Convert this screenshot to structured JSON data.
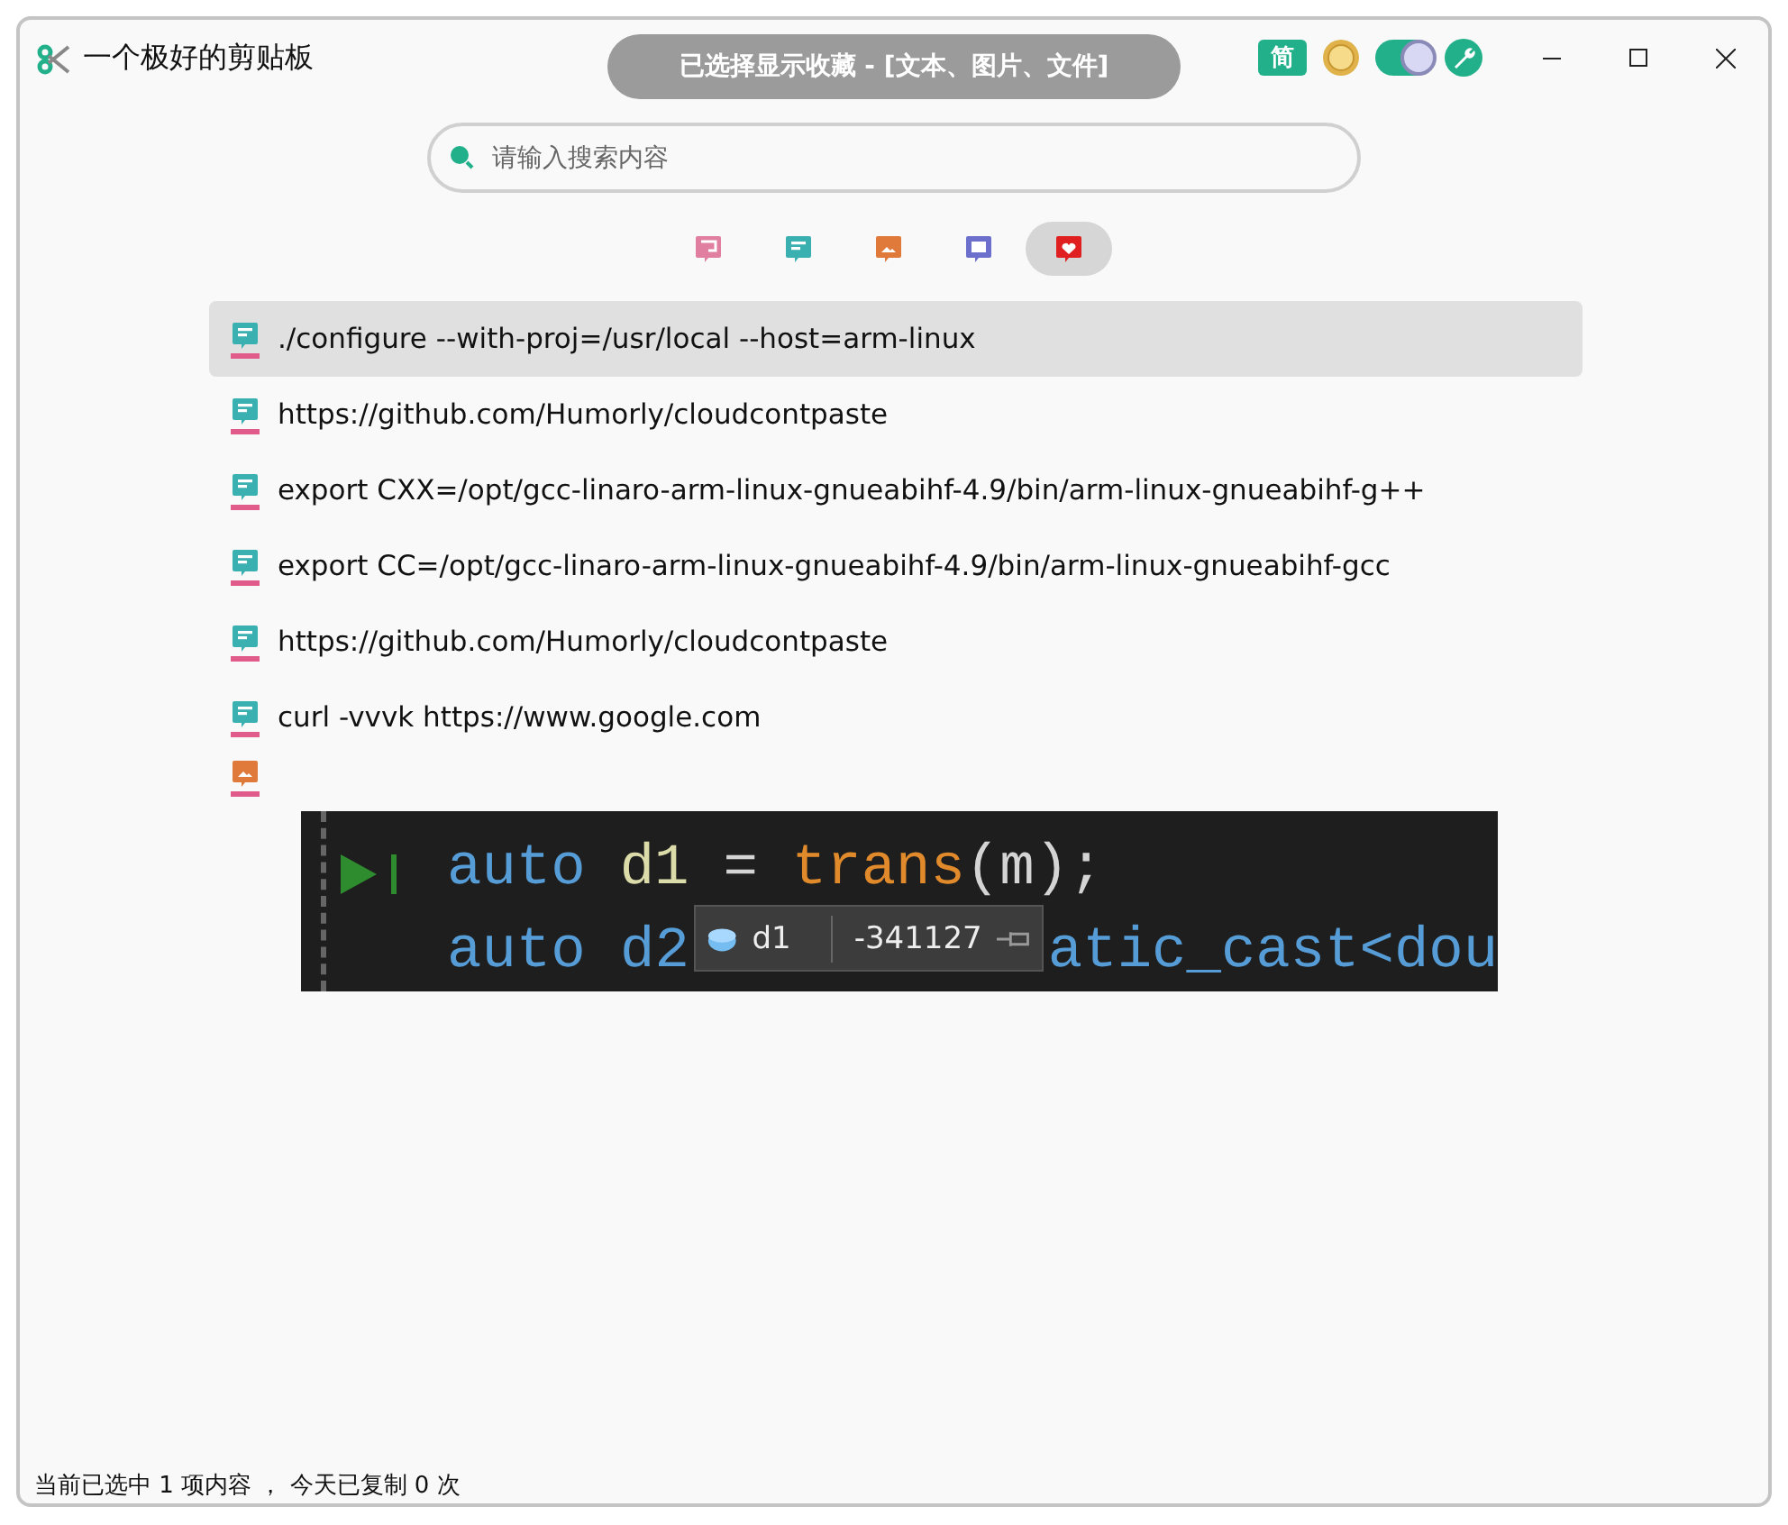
{
  "window": {
    "title": "一个极好的剪贴板"
  },
  "banner": "已选择显示收藏 - [文本、图片、文件]",
  "toolbar": {
    "language_badge": "简",
    "theme_toggle": {
      "on": true
    }
  },
  "search": {
    "placeholder": "请输入搜索内容"
  },
  "filters": [
    {
      "kind": "all",
      "selected": false
    },
    {
      "kind": "text",
      "selected": false
    },
    {
      "kind": "image",
      "selected": false
    },
    {
      "kind": "file",
      "selected": false
    },
    {
      "kind": "favorite",
      "selected": true
    }
  ],
  "items": [
    {
      "kind": "text",
      "text": "./configure --with-proj=/usr/local --host=arm-linux",
      "selected": true
    },
    {
      "kind": "text",
      "text": "https://github.com/Humorly/cloudcontpaste",
      "selected": false
    },
    {
      "kind": "text",
      "text": "export CXX=/opt/gcc-linaro-arm-linux-gnueabihf-4.9/bin/arm-linux-gnueabihf-g++",
      "selected": false
    },
    {
      "kind": "text",
      "text": "export CC=/opt/gcc-linaro-arm-linux-gnueabihf-4.9/bin/arm-linux-gnueabihf-gcc",
      "selected": false
    },
    {
      "kind": "text",
      "text": "https://github.com/Humorly/cloudcontpaste",
      "selected": false
    },
    {
      "kind": "text",
      "text": "curl -vvvk https://www.google.com",
      "selected": false
    },
    {
      "kind": "image",
      "selected": false,
      "code": {
        "lines": [
          [
            {
              "kind": "keyword",
              "text": "auto"
            },
            {
              "kind": "var",
              "text": "d1"
            },
            {
              "kind": "op",
              "text": "="
            },
            {
              "kind": "func",
              "text": "trans"
            },
            {
              "kind": "plain",
              "text": "(m);"
            }
          ],
          [
            {
              "kind": "keyword",
              "text": "auto d2"
            },
            {
              "kind": "keyword",
              "text": "atic_cast<dou"
            }
          ]
        ],
        "tooltip": {
          "name": "d1",
          "value": "-341127"
        }
      }
    }
  ],
  "status_bar": "当前已选中 1 项内容 ， 今天已复制 0 次"
}
